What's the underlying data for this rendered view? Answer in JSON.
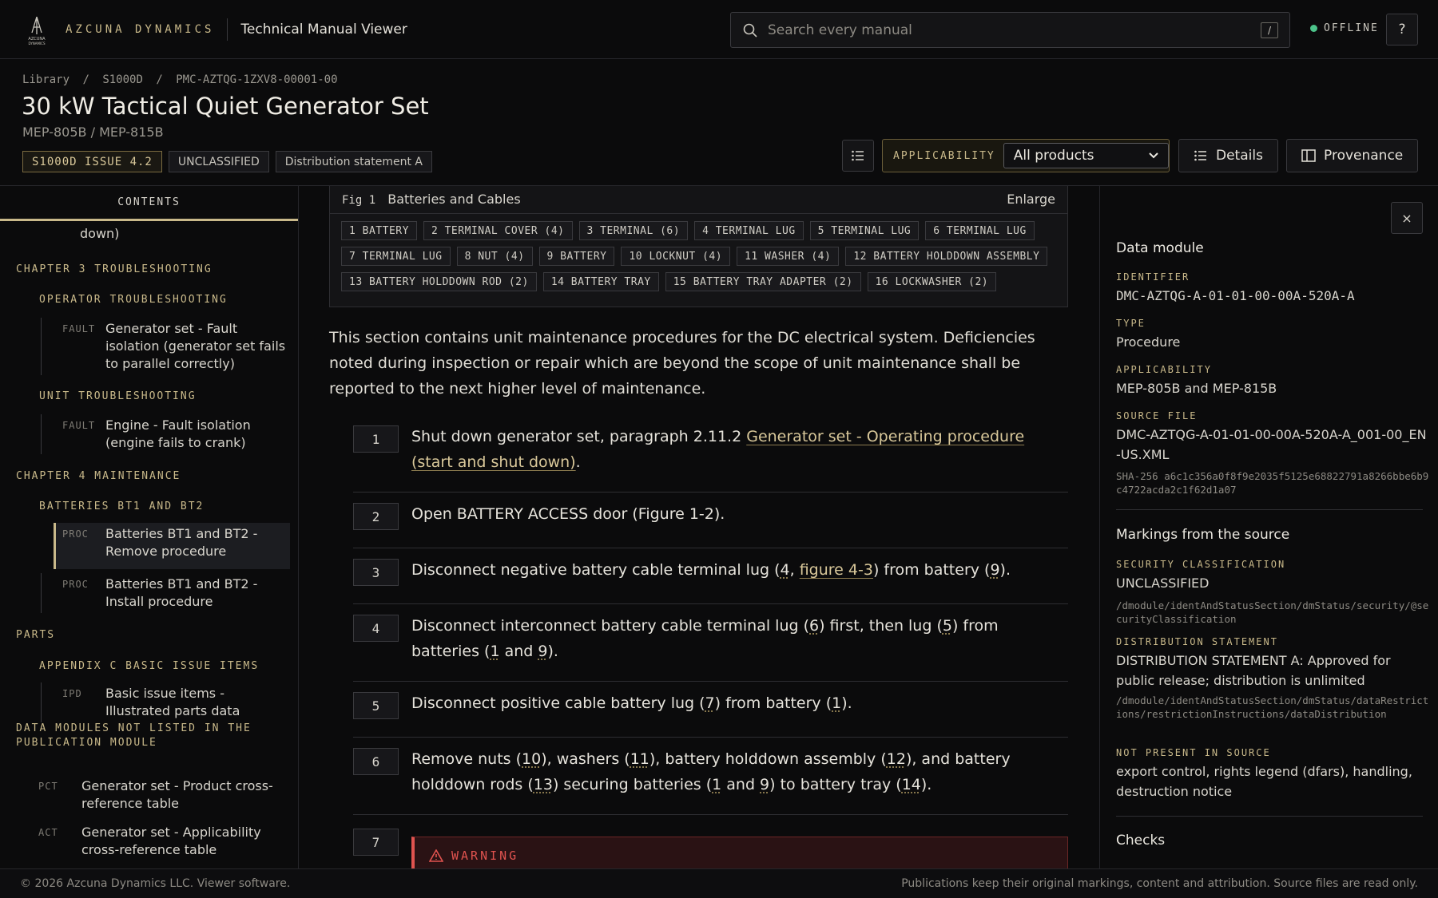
{
  "brand": {
    "name": "AZCUNA DYNAMICS",
    "logo_text": "AZCUNA DYNAMICS"
  },
  "app_title": "Technical Manual Viewer",
  "search": {
    "placeholder": "Search every manual",
    "shortcut": "/"
  },
  "status": {
    "label": "OFFLINE",
    "color": "#4cc38a"
  },
  "help_label": "?",
  "breadcrumb": [
    "Library",
    "/",
    "S1000D",
    "/",
    "PMC-AZTQG-1ZXV8-00001-00"
  ],
  "title": "30 kW Tactical Quiet Generator Set",
  "subtitle": "MEP-805B / MEP-815B",
  "badges": [
    "S1000D ISSUE 4.2",
    "UNCLASSIFIED",
    "Distribution statement A"
  ],
  "toolbar": {
    "applicability_label": "APPLICABILITY",
    "applicability_value": "All products",
    "details_label": "Details",
    "provenance_label": "Provenance"
  },
  "sidebar": {
    "heading": "CONTENTS",
    "cut_text": "down)",
    "chapters": [
      {
        "title": "CHAPTER 3 TROUBLESHOOTING"
      },
      {
        "title": "CHAPTER 4 MAINTENANCE"
      },
      {
        "title": "PARTS"
      },
      {
        "title": "DATA MODULES NOT LISTED IN THE PUBLICATION MODULE"
      }
    ],
    "sections": [
      "OPERATOR TROUBLESHOOTING",
      "UNIT TROUBLESHOOTING",
      "BATTERIES BT1 AND BT2",
      "APPENDIX C BASIC ISSUE ITEMS"
    ],
    "items": [
      {
        "type": "FAULT",
        "label": "Generator set - Fault isolation (generator set fails to parallel correctly)"
      },
      {
        "type": "FAULT",
        "label": "Engine - Fault isolation (engine fails to crank)"
      },
      {
        "type": "PROC",
        "label": "Batteries BT1 and BT2 - Remove procedure"
      },
      {
        "type": "PROC",
        "label": "Batteries BT1 and BT2 - Install procedure"
      },
      {
        "type": "IPD",
        "label": "Basic issue items - Illustrated parts data"
      },
      {
        "type": "PCT",
        "label": "Generator set - Product cross-reference table"
      },
      {
        "type": "ACT",
        "label": "Generator set - Applicability cross-reference table"
      }
    ]
  },
  "figure": {
    "number": "Fig 1",
    "title": "Batteries and Cables",
    "enlarge_label": "Enlarge",
    "parts": [
      "1 BATTERY",
      "2 TERMINAL COVER (4)",
      "3 TERMINAL (6)",
      "4 TERMINAL LUG",
      "5 TERMINAL LUG",
      "6 TERMINAL LUG",
      "7 TERMINAL LUG",
      "8 NUT (4)",
      "9 BATTERY",
      "10 LOCKNUT (4)",
      "11 WASHER (4)",
      "12 BATTERY HOLDDOWN ASSEMBLY",
      "13 BATTERY HOLDDOWN ROD (2)",
      "14 BATTERY TRAY",
      "15 BATTERY TRAY ADAPTER (2)",
      "16 LOCKWASHER (2)"
    ]
  },
  "intro": "This section contains unit maintenance procedures for the DC electrical system. Deficiencies noted during inspection or repair which are beyond the scope of unit maintenance shall be reported to the next higher level of maintenance.",
  "steps": {
    "s1": {
      "num": "1",
      "pre": "Shut down generator set, paragraph 2.11.2 ",
      "link": "Generator set - Operating procedure (start and shut down)",
      "post": "."
    },
    "s2": {
      "num": "2",
      "text": "Open BATTERY ACCESS door (Figure 1-2)."
    },
    "s3": {
      "num": "3",
      "a": "Disconnect negative battery cable terminal lug (",
      "r1": "4",
      "b": ", ",
      "link": "figure 4-3",
      "c": ") from battery (",
      "r2": "9",
      "d": ")."
    },
    "s4": {
      "num": "4",
      "a": "Disconnect interconnect battery cable terminal lug (",
      "r1": "6",
      "b": ") first, then lug (",
      "r2": "5",
      "c": ") from batteries (",
      "r3": "1",
      "d": " and ",
      "r4": "9",
      "e": ")."
    },
    "s5": {
      "num": "5",
      "a": "Disconnect positive cable battery lug (",
      "r1": "7",
      "b": ") from battery (",
      "r2": "1",
      "c": ")."
    },
    "s6": {
      "num": "6",
      "a": "Remove nuts (",
      "r1": "10",
      "b": "), washers (",
      "r2": "11",
      "c": "), battery holddown assembly (",
      "r3": "12",
      "d": "), and battery holddown rods (",
      "r4": "13",
      "e": ") securing batteries (",
      "r5": "1",
      "f": " and ",
      "r6": "9",
      "g": ") to battery tray (",
      "r7": "14",
      "h": ")."
    },
    "s7": {
      "num": "7",
      "warning": "WARNING"
    }
  },
  "details": {
    "close_label": "×",
    "data_module_heading": "Data module",
    "identifier_label": "IDENTIFIER",
    "identifier": "DMC-AZTQG-A-01-01-00-00A-520A-A",
    "type_label": "TYPE",
    "type": "Procedure",
    "applicability_label": "APPLICABILITY",
    "applicability": "MEP-805B and MEP-815B",
    "source_file_label": "SOURCE FILE",
    "source_file": "DMC-AZTQG-A-01-01-00-00A-520A-A_001-00_EN-US.XML",
    "sha": "SHA-256 a6c1c356a0f8f9e2035f5125e68822791a8266bbe6b9c4722acda2c1f62d1a07",
    "markings_heading": "Markings from the source",
    "security_label": "SECURITY CLASSIFICATION",
    "security": "UNCLASSIFIED",
    "security_path": "/dmodule/identAndStatusSection/dmStatus/security/@securityClassification",
    "distribution_label": "DISTRIBUTION STATEMENT",
    "distribution": "DISTRIBUTION STATEMENT A: Approved for public release; distribution is unlimited",
    "distribution_path": "/dmodule/identAndStatusSection/dmStatus/dataRestrictions/restrictionInstructions/dataDistribution",
    "not_present_label": "NOT PRESENT IN SOURCE",
    "not_present": "export control, rights legend (dfars), handling, destruction notice",
    "checks_heading": "Checks"
  },
  "footer": {
    "left": "© 2026 Azcuna Dynamics LLC. Viewer software.",
    "right": "Publications keep their original markings, content and attribution. Source files are read only."
  },
  "colors": {
    "accent": "#c9b98a",
    "background": "#0b0b0c",
    "warning": "#e0534f"
  }
}
